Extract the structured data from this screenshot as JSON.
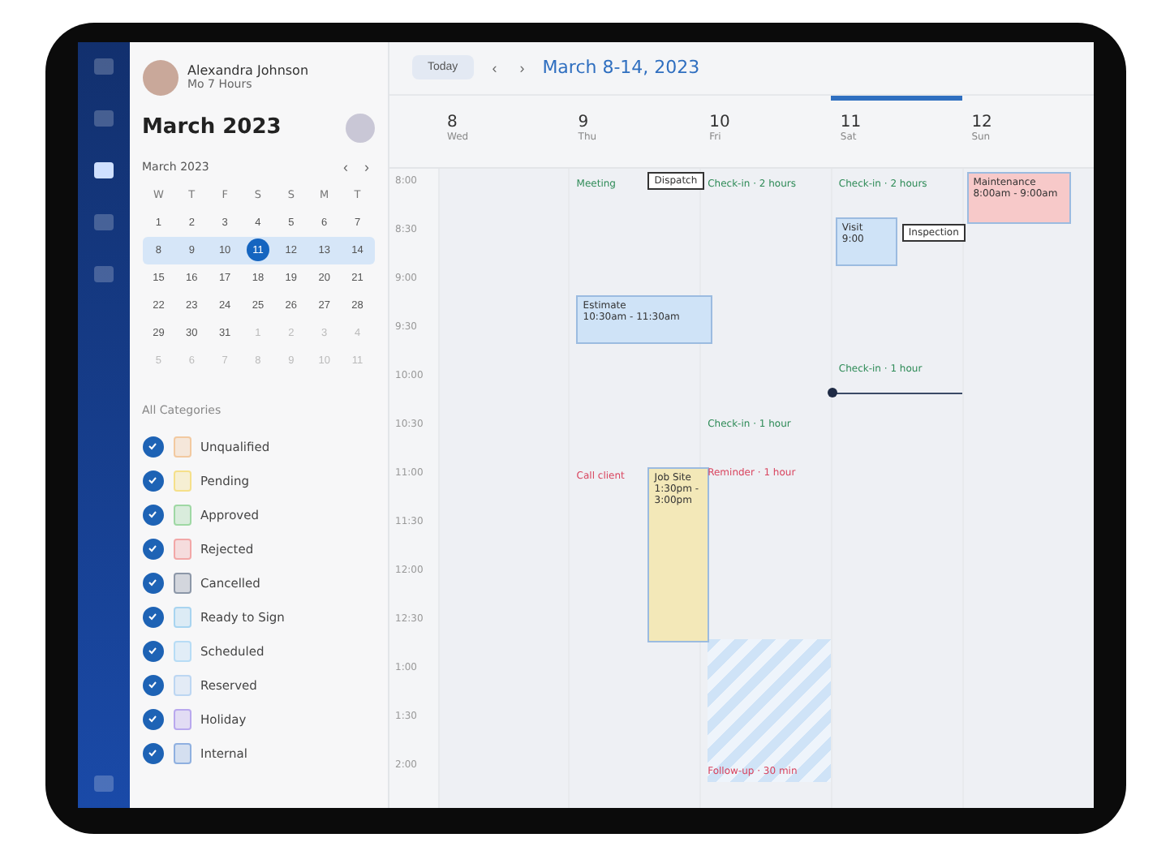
{
  "user": {
    "name": "Alexandra Johnson",
    "subtitle": "Mo 7 Hours"
  },
  "sidebar": {
    "title": "March 2023",
    "mini_calendar": {
      "title": "March 2023",
      "prev": "‹",
      "next": "›",
      "weekdays": [
        "W",
        "T",
        "F",
        "S",
        "S",
        "M",
        "T"
      ],
      "weeks": [
        {
          "selected": false,
          "days": [
            {
              "label": "1",
              "selected": false,
              "muted": false
            },
            {
              "label": "2",
              "selected": false,
              "muted": false
            },
            {
              "label": "3",
              "selected": false,
              "muted": false
            },
            {
              "label": "4",
              "selected": false,
              "muted": false
            },
            {
              "label": "5",
              "selected": false,
              "muted": false
            },
            {
              "label": "6",
              "selected": false,
              "muted": false
            },
            {
              "label": "7",
              "selected": false,
              "muted": false
            }
          ]
        },
        {
          "selected": true,
          "days": [
            {
              "label": "8",
              "selected": false,
              "muted": false
            },
            {
              "label": "9",
              "selected": false,
              "muted": false
            },
            {
              "label": "10",
              "selected": false,
              "muted": false
            },
            {
              "label": "11",
              "selected": true,
              "muted": false
            },
            {
              "label": "12",
              "selected": false,
              "muted": false
            },
            {
              "label": "13",
              "selected": false,
              "muted": false
            },
            {
              "label": "14",
              "selected": false,
              "muted": false
            }
          ]
        },
        {
          "selected": false,
          "days": [
            {
              "label": "15",
              "selected": false,
              "muted": false
            },
            {
              "label": "16",
              "selected": false,
              "muted": false
            },
            {
              "label": "17",
              "selected": false,
              "muted": false
            },
            {
              "label": "18",
              "selected": false,
              "muted": false
            },
            {
              "label": "19",
              "selected": false,
              "muted": false
            },
            {
              "label": "20",
              "selected": false,
              "muted": false
            },
            {
              "label": "21",
              "selected": false,
              "muted": false
            }
          ]
        },
        {
          "selected": false,
          "days": [
            {
              "label": "22",
              "selected": false,
              "muted": false
            },
            {
              "label": "23",
              "selected": false,
              "muted": false
            },
            {
              "label": "24",
              "selected": false,
              "muted": false
            },
            {
              "label": "25",
              "selected": false,
              "muted": false
            },
            {
              "label": "26",
              "selected": false,
              "muted": false
            },
            {
              "label": "27",
              "selected": false,
              "muted": false
            },
            {
              "label": "28",
              "selected": false,
              "muted": false
            }
          ]
        },
        {
          "selected": false,
          "days": [
            {
              "label": "29",
              "selected": false,
              "muted": false
            },
            {
              "label": "30",
              "selected": false,
              "muted": false
            },
            {
              "label": "31",
              "selected": false,
              "muted": false
            },
            {
              "label": "1",
              "selected": false,
              "muted": true
            },
            {
              "label": "2",
              "selected": false,
              "muted": true
            },
            {
              "label": "3",
              "selected": false,
              "muted": true
            },
            {
              "label": "4",
              "selected": false,
              "muted": true
            }
          ]
        },
        {
          "selected": false,
          "days": [
            {
              "label": "5",
              "selected": false,
              "muted": true
            },
            {
              "label": "6",
              "selected": false,
              "muted": true
            },
            {
              "label": "7",
              "selected": false,
              "muted": true
            },
            {
              "label": "8",
              "selected": false,
              "muted": true
            },
            {
              "label": "9",
              "selected": false,
              "muted": true
            },
            {
              "label": "10",
              "selected": false,
              "muted": true
            },
            {
              "label": "11",
              "selected": false,
              "muted": true
            }
          ]
        }
      ]
    },
    "filter_title": "All Categories",
    "categories": [
      {
        "label": "Unqualified",
        "checked": true,
        "color": "#f2c9a0"
      },
      {
        "label": "Pending",
        "checked": true,
        "color": "#f5e08a"
      },
      {
        "label": "Approved",
        "checked": true,
        "color": "#9fd8a4"
      },
      {
        "label": "Rejected",
        "checked": true,
        "color": "#f2a7a7"
      },
      {
        "label": "Cancelled",
        "checked": true,
        "color": "#8c97a8"
      },
      {
        "label": "Ready to Sign",
        "checked": true,
        "color": "#a8d4f0"
      },
      {
        "label": "Scheduled",
        "checked": true,
        "color": "#b7dcf5"
      },
      {
        "label": "Reserved",
        "checked": true,
        "color": "#bcd6f2"
      },
      {
        "label": "Holiday",
        "checked": true,
        "color": "#b9a8ee"
      },
      {
        "label": "Internal",
        "checked": true,
        "color": "#8fb0e0"
      }
    ]
  },
  "toolbar": {
    "today": "Today",
    "prev": "‹",
    "next": "›",
    "range": "March 8-14, 2023"
  },
  "days": [
    {
      "number": "8",
      "weekday": "Wed",
      "selected": false
    },
    {
      "number": "9",
      "weekday": "Thu",
      "selected": false,
      "events": [
        {
          "kind": "tag",
          "title": "Meeting",
          "color": "#2e8b57"
        },
        {
          "kind": "outline",
          "title": "Dispatch"
        },
        {
          "kind": "block",
          "title": "Estimate",
          "time": "10:30am - 11:30am",
          "color": "#cfe3f7"
        },
        {
          "kind": "tag",
          "title": "Call client",
          "color": "#d9455f"
        },
        {
          "kind": "block",
          "title": "Job Site",
          "time": "1:30pm - 3:00pm",
          "color": "#f3e8b8"
        }
      ]
    },
    {
      "number": "10",
      "weekday": "Fri",
      "selected": false,
      "events": [
        {
          "kind": "tag",
          "title": "Check-in · 2 hours",
          "color": "#2e8b57"
        },
        {
          "kind": "tag",
          "title": "Check-in · 1 hour",
          "color": "#2e8b57"
        },
        {
          "kind": "tag",
          "title": "Reminder · 1 hour",
          "color": "#d9455f"
        },
        {
          "kind": "striped"
        },
        {
          "kind": "tag",
          "title": "Follow-up · 30 min",
          "color": "#d9455f"
        }
      ]
    },
    {
      "number": "11",
      "weekday": "Sat",
      "selected": true,
      "events": [
        {
          "kind": "tag",
          "title": "Check-in · 2 hours",
          "color": "#2e8b57"
        },
        {
          "kind": "block",
          "title": "Visit",
          "time": "9:00",
          "color": "#cfe3f7"
        },
        {
          "kind": "outline",
          "title": "Inspection"
        },
        {
          "kind": "tag",
          "title": "Check-in · 1 hour",
          "color": "#2e8b57"
        },
        {
          "kind": "now"
        }
      ]
    },
    {
      "number": "12",
      "weekday": "Sun",
      "selected": false,
      "events": [
        {
          "kind": "block",
          "title": "Maintenance",
          "time": "8:00am - 9:00am",
          "color": "#f7c9c9"
        }
      ]
    }
  ],
  "times": [
    "8:00",
    "8:30",
    "9:00",
    "9:30",
    "10:00",
    "10:30",
    "11:00",
    "11:30",
    "12:00",
    "12:30",
    "1:00",
    "1:30",
    "2:00"
  ]
}
